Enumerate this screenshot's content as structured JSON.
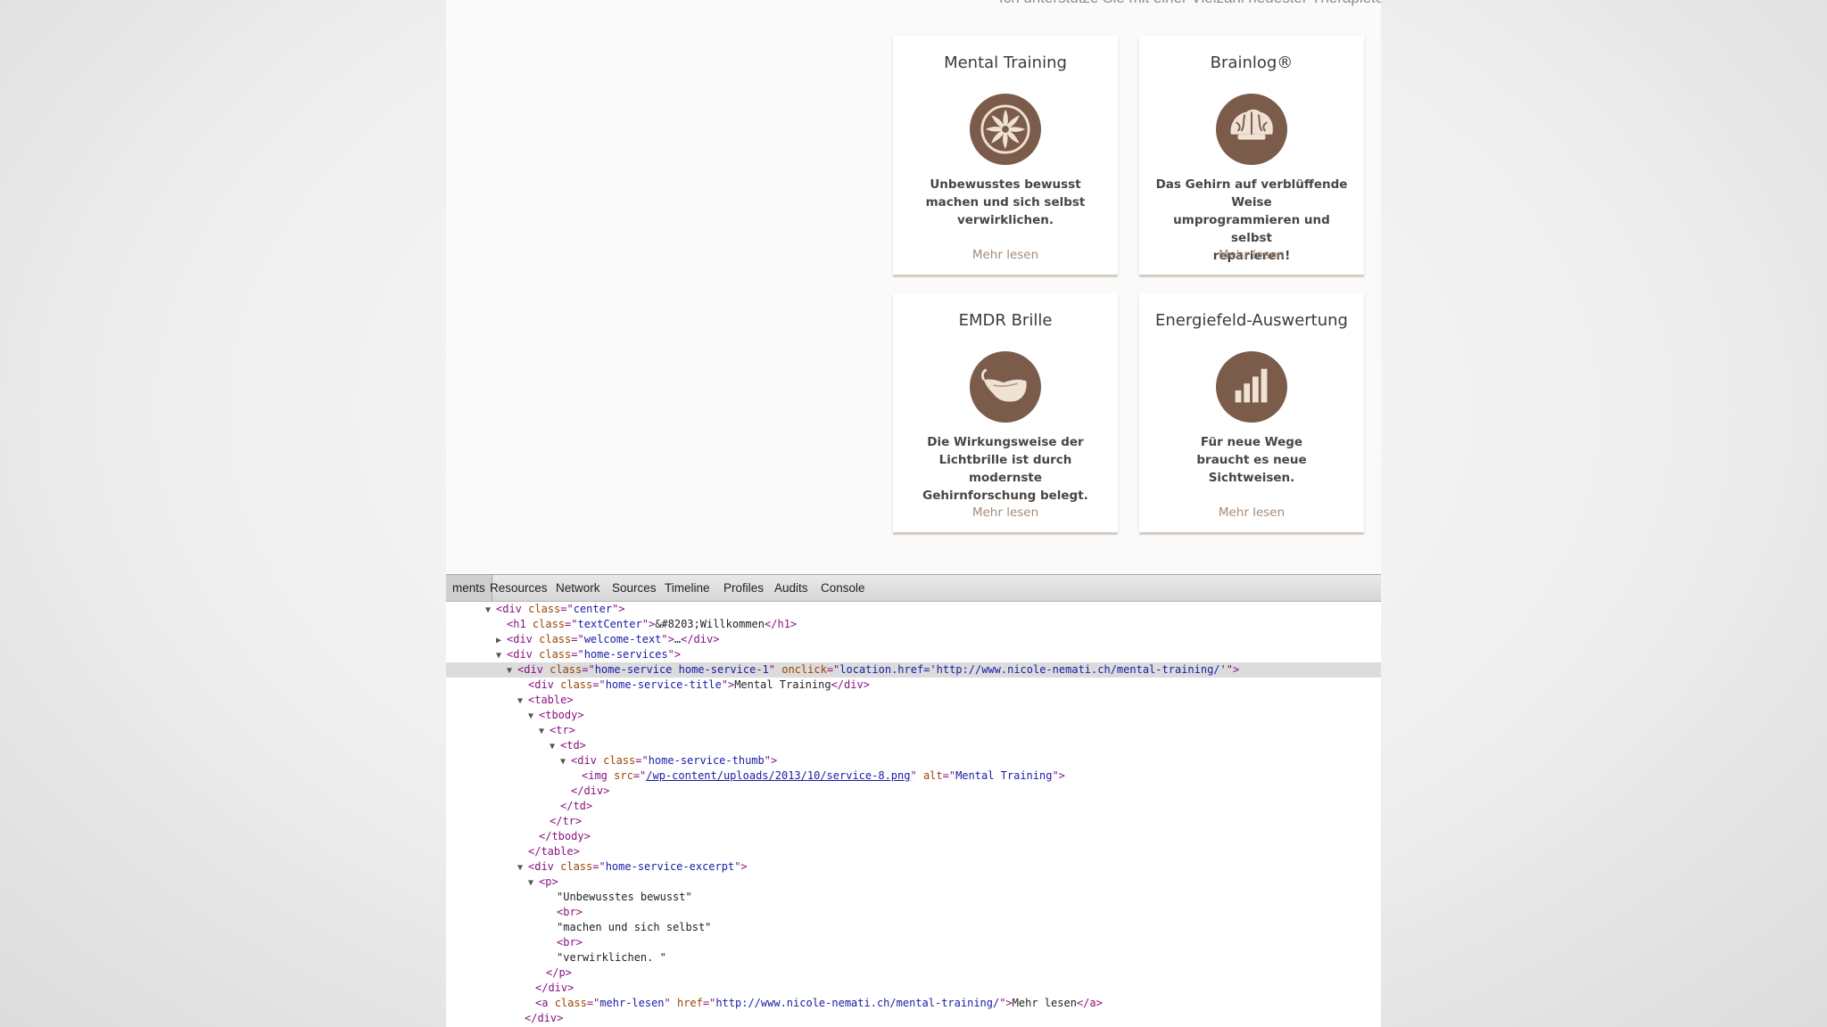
{
  "site": {
    "tagline": "Ich unterstütze Sie mit einer Vielzahl neuester Therapietechniken",
    "services": [
      {
        "title": "Mental Training",
        "icon": "pinwheel-icon",
        "excerpt": [
          "Unbewusstes bewusst",
          "machen und sich selbst",
          "verwirklichen."
        ],
        "more": "Mehr lesen"
      },
      {
        "title": "Brainlog®",
        "icon": "brain-icon",
        "excerpt": [
          "Das Gehirn auf verblüffende Weise",
          "umprogrammieren und selbst",
          "reparieren!"
        ],
        "more": "Mehr lesen"
      },
      {
        "title": "EMDR Brille",
        "icon": "glasses-icon",
        "excerpt": [
          "Die Wirkungsweise der",
          "Lichtbrille ist durch modernste",
          "Gehirnforschung belegt."
        ],
        "more": "Mehr lesen"
      },
      {
        "title": "Energiefeld-Auswertung",
        "icon": "bar-chart-icon",
        "excerpt": [
          "Für neue Wege",
          "braucht es neue",
          "Sichtweisen."
        ],
        "more": "Mehr lesen"
      }
    ],
    "colors": {
      "accent": "#7b5b4a",
      "link": "#a48b78",
      "icon_fg": "#efe1d4"
    }
  },
  "devtools": {
    "tabs": [
      "ments",
      "Resources",
      "Network",
      "Sources",
      "Timeline",
      "Profiles",
      "Audits",
      "Console"
    ],
    "active_tab": "ments",
    "dom": {
      "center_class": "center",
      "h1_class": "textCenter",
      "h1_text": "&#8203;Willkommen",
      "welcome_class": "welcome-text",
      "services_class": "home-services",
      "service_class": "home-service home-service-1",
      "service_onclick": "location.href='http://www.nicole-nemati.ch/mental-training/'",
      "title_class": "home-service-title",
      "title_text": "Mental Training",
      "thumb_class": "home-service-thumb",
      "img_src": "/wp-content/uploads/2013/10/service-8.png",
      "img_alt": "Mental Training",
      "excerpt_class": "home-service-excerpt",
      "text1": "\"Unbewusstes bewusst\"",
      "text2": "\"machen und sich selbst\"",
      "text3": "\"verwirklichen. \"",
      "more_class": "mehr-lesen",
      "more_href": "http://www.nicole-nemati.ch/mental-training/",
      "more_text": "Mehr lesen"
    }
  }
}
